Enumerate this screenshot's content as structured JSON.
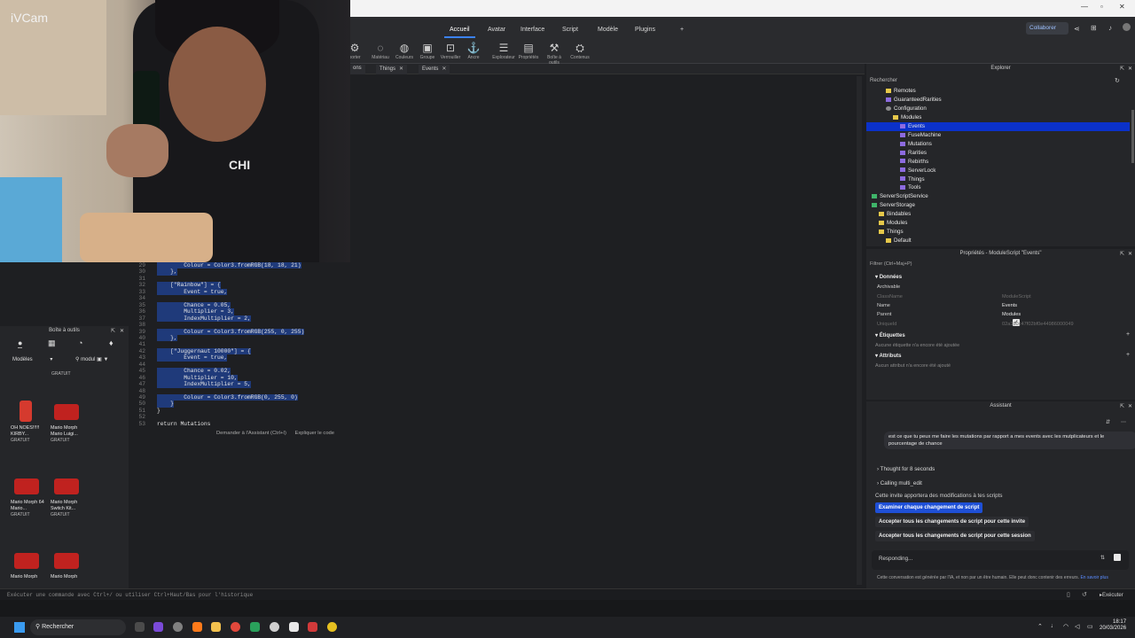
{
  "ribbon": {
    "tabs": [
      "Accueil",
      "Avatar",
      "Interface",
      "Script",
      "Modèle",
      "Plugins",
      "+"
    ],
    "collaborate": "Collaborer",
    "tools": {
      "importer": "porter",
      "materials": "Matériau",
      "colors": "Couleurs",
      "group": "Groupe",
      "lock": "Verrouiller",
      "anchor": "Ancre",
      "explorer": "Explorateur",
      "properties": "Propriétés",
      "toolbox": "Boîte à outils",
      "contents": "Contenus"
    }
  },
  "file_tabs": [
    {
      "label": "ons"
    },
    {
      "label": "Things"
    },
    {
      "label": "Events"
    }
  ],
  "webcam": {
    "label": "iVCam",
    "shirt_text": "CHI"
  },
  "editor": {
    "lines": [
      {
        "n": "29",
        "text": "        Colour = Color3.fromRGB(18, 18, 21)"
      },
      {
        "n": "30",
        "text": "    },"
      },
      {
        "n": "31",
        "text": ""
      },
      {
        "n": "32",
        "text": "    [\"Rainbow\"] = {"
      },
      {
        "n": "33",
        "text": "        Event = true,"
      },
      {
        "n": "34",
        "text": ""
      },
      {
        "n": "35",
        "text": "        Chance = 0.05,"
      },
      {
        "n": "36",
        "text": "        Multiplier = 3,"
      },
      {
        "n": "37",
        "text": "        IndexMultiplier = 2,"
      },
      {
        "n": "38",
        "text": ""
      },
      {
        "n": "39",
        "text": "        Colour = Color3.fromRGB(255, 0, 255)"
      },
      {
        "n": "40",
        "text": "    },"
      },
      {
        "n": "41",
        "text": ""
      },
      {
        "n": "42",
        "text": "    [\"Juggernaut 10000\"] = {"
      },
      {
        "n": "43",
        "text": "        Event = true,"
      },
      {
        "n": "44",
        "text": ""
      },
      {
        "n": "45",
        "text": "        Chance = 0.02,"
      },
      {
        "n": "46",
        "text": "        Multiplier = 10,"
      },
      {
        "n": "47",
        "text": "        IndexMultiplier = 5,"
      },
      {
        "n": "48",
        "text": ""
      },
      {
        "n": "49",
        "text": "        Colour = Color3.fromRGB(0, 255, 0)"
      },
      {
        "n": "50",
        "text": "    }"
      },
      {
        "n": "51",
        "text": "}"
      },
      {
        "n": "52",
        "text": ""
      },
      {
        "n": "53",
        "text": "return Mutations"
      }
    ],
    "ask_assistant": "Demander à l'Assistant (Ctrl+I)",
    "explain_code": "Expliquer le code"
  },
  "toolbox": {
    "title": "Boîte à outils",
    "filter": "Modèles",
    "search_value": "modul",
    "items": [
      {
        "name": "",
        "price": "GRATUIT"
      },
      {
        "name": "OH NOES!!!!! KIRBY...",
        "price": "GRATUIT"
      },
      {
        "name": "Mario Morph Mario Luigi...",
        "price": "GRATUIT"
      },
      {
        "name": "Mario Morph 64 Mario...",
        "price": "GRATUIT"
      },
      {
        "name": "Mario Morph Switch Kit...",
        "price": "GRATUIT"
      },
      {
        "name": "Mario Morph",
        "price": ""
      },
      {
        "name": "Mario Morph",
        "price": ""
      }
    ]
  },
  "explorer": {
    "title": "Explorer",
    "search_placeholder": "Rechercher",
    "tree": [
      {
        "label": "Remotes",
        "icon": "folder",
        "level": 2
      },
      {
        "label": "GuaranteedRarities",
        "icon": "module",
        "level": 2
      },
      {
        "label": "Configuration",
        "icon": "gear",
        "level": 2
      },
      {
        "label": "Modules",
        "icon": "folder",
        "level": 3
      },
      {
        "label": "Events",
        "icon": "module",
        "level": 4,
        "selected": true
      },
      {
        "label": "FuseMachine",
        "icon": "module",
        "level": 4
      },
      {
        "label": "Mutations",
        "icon": "module",
        "level": 4
      },
      {
        "label": "Rarities",
        "icon": "module",
        "level": 4
      },
      {
        "label": "Rebirths",
        "icon": "module",
        "level": 4
      },
      {
        "label": "ServerLock",
        "icon": "module",
        "level": 4
      },
      {
        "label": "Things",
        "icon": "module",
        "level": 4
      },
      {
        "label": "Tools",
        "icon": "module",
        "level": 4
      },
      {
        "label": "ServerScriptService",
        "icon": "service",
        "level": 0
      },
      {
        "label": "ServerStorage",
        "icon": "service",
        "level": 0
      },
      {
        "label": "Bindables",
        "icon": "folder",
        "level": 1
      },
      {
        "label": "Modules",
        "icon": "folder",
        "level": 1
      },
      {
        "label": "Things",
        "icon": "folder",
        "level": 1
      },
      {
        "label": "Default",
        "icon": "folder",
        "level": 2
      }
    ]
  },
  "properties": {
    "title": "Propriétés - ModuleScript \"Events\"",
    "filter": "Filtrer (Ctrl+Maj+P)",
    "sections": {
      "data": "Données",
      "tags": "Étiquettes",
      "attributes": "Attributs"
    },
    "rows": [
      {
        "k": "Archivable",
        "v": "",
        "checkbox": true
      },
      {
        "k": "ClassName",
        "v": "ModuleScript",
        "dim": true
      },
      {
        "k": "Name",
        "v": "Events"
      },
      {
        "k": "Parent",
        "v": "Modules"
      },
      {
        "k": "UniqueId",
        "v": "02a1b0c47f02bf0e44986000049",
        "dim": true
      }
    ],
    "no_tags": "Aucune étiquette n'a encore été ajoutée",
    "no_attributes": "Aucun attribut n'a encore été ajouté"
  },
  "assistant": {
    "title": "Assistant",
    "user_message": "est ce que tu peux me faire les mutations par rapport a mes events avec les mutplicateurs et le pourcentage de chance",
    "thought": "Thought for 8 seconds",
    "calling": "Calling multi_edit",
    "notice": "Cette invite apportera des modifications à tes scripts",
    "btn_review": "Examiner chaque changement de script",
    "btn_accept_invite": "Accepter tous les changements de script pour cette invite",
    "btn_accept_session": "Accepter tous les changements de script pour cette session",
    "input_status": "Responding...",
    "footer": "Cette conversation est générée par l'IA, et non par un être humain. Elle peut donc contenir des erreurs.",
    "footer_link": "En savoir plus"
  },
  "command_bar": {
    "placeholder": "Exécuter une commande avec Ctrl+/ ou utiliser Ctrl+Haut/Bas pour l'historique",
    "execute": "Exécuter"
  },
  "taskbar": {
    "search": "Rechercher",
    "time": "18:17",
    "date": "20/03/2026"
  }
}
